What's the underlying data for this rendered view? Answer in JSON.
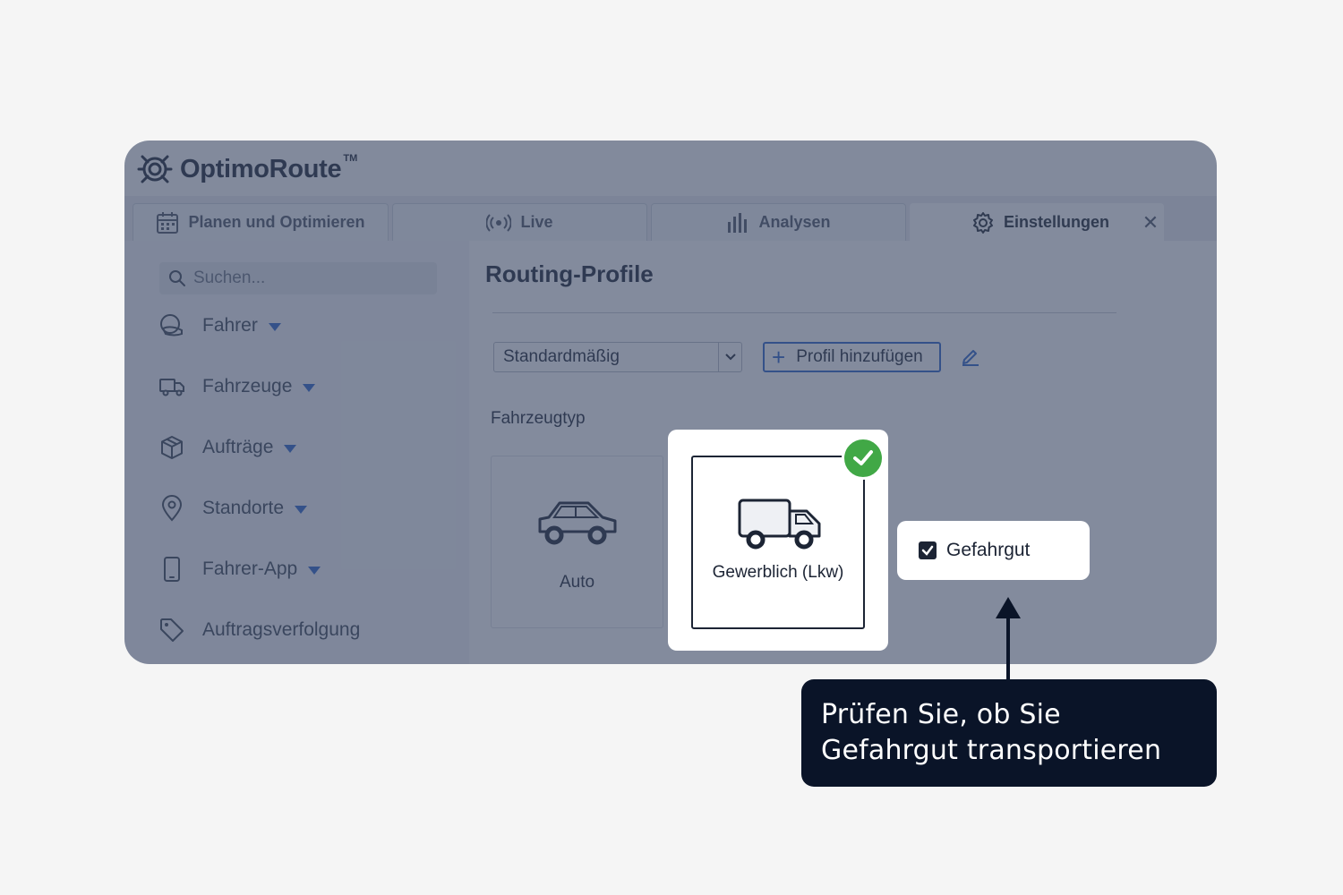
{
  "app": {
    "name": "OptimoRoute",
    "trademark": "TM"
  },
  "tabs": [
    {
      "label": "Planen und Optimieren",
      "icon": "calendar-icon"
    },
    {
      "label": "Live",
      "icon": "broadcast-icon"
    },
    {
      "label": "Analysen",
      "icon": "bar-chart-icon"
    },
    {
      "label": "Einstellungen",
      "icon": "gear-icon",
      "active": true
    }
  ],
  "tab_close": "✕",
  "sidebar": {
    "search_placeholder": "Suchen...",
    "items": [
      {
        "label": "Fahrer",
        "icon": "driver-icon"
      },
      {
        "label": "Fahrzeuge",
        "icon": "truck-icon"
      },
      {
        "label": "Aufträge",
        "icon": "package-icon"
      },
      {
        "label": "Standorte",
        "icon": "location-pin-icon"
      },
      {
        "label": "Fahrer-App",
        "icon": "phone-icon"
      },
      {
        "label": "Auftragsverfolgung",
        "icon": "tag-icon"
      }
    ]
  },
  "main": {
    "title": "Routing-Profile",
    "profile_select": "Standardmäßig",
    "add_profile": "Profil hinzufügen",
    "section_label": "Fahrzeugtyp",
    "vehicle_types": [
      {
        "label": "Auto",
        "icon": "car-icon",
        "selected": false
      },
      {
        "label": "Gewerblich (Lkw)",
        "icon": "truck-icon",
        "selected": true
      }
    ],
    "hazmat_label": "Gefahrgut",
    "hazmat_checked": true
  },
  "callout": {
    "line1": "Prüfen Sie, ob Sie",
    "line2": "Gefahrgut transportieren"
  },
  "colors": {
    "accent": "#2a62c9",
    "success": "#41a846",
    "callout_bg": "#0a1428",
    "overlay": "#3a4864"
  }
}
